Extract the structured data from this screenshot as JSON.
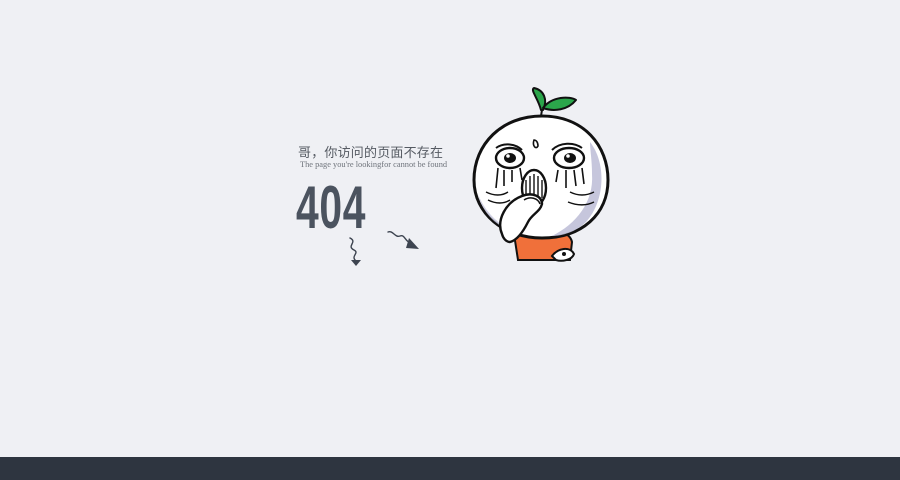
{
  "error": {
    "message_cn": "哥，你访问的页面不存在",
    "message_en": "The page you're lookingfor cannot be found",
    "code": "404"
  },
  "icons": {
    "arrow_left": "squiggle-down-arrow-icon",
    "arrow_right": "squiggle-right-arrow-icon",
    "mascot": "crying-radish-mascot"
  },
  "colors": {
    "background": "#eff0f4",
    "text_dark": "#4b535f",
    "footer": "#2e3540",
    "leaf_green": "#2ba64b",
    "shirt_orange": "#f0703a"
  }
}
